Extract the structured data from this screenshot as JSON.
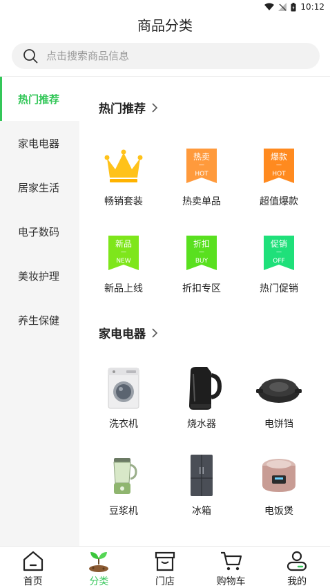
{
  "status": {
    "time": "10:12"
  },
  "header": {
    "title": "商品分类"
  },
  "search": {
    "placeholder": "点击搜索商品信息"
  },
  "sidebar": {
    "items": [
      {
        "label": "热门推荐",
        "active": true
      },
      {
        "label": "家电电器"
      },
      {
        "label": "居家生活"
      },
      {
        "label": "电子数码"
      },
      {
        "label": "美妆护理"
      },
      {
        "label": "养生保健"
      }
    ]
  },
  "sections": [
    {
      "title": "热门推荐",
      "items": [
        {
          "label": "畅销套装",
          "icon": "crown-icon"
        },
        {
          "label": "热卖单品",
          "icon": "tag-hot",
          "tag_top": "热卖",
          "tag_bottom": "HOT",
          "color": "#ff9a3c"
        },
        {
          "label": "超值爆款",
          "icon": "tag-hot",
          "tag_top": "爆款",
          "tag_bottom": "HOT",
          "color": "#ff8a1f"
        },
        {
          "label": "新品上线",
          "icon": "tag-new",
          "tag_top": "新品",
          "tag_bottom": "NEW",
          "color": "#7ee61b"
        },
        {
          "label": "折扣专区",
          "icon": "tag-buy",
          "tag_top": "折扣",
          "tag_bottom": "BUY",
          "color": "#59e01f"
        },
        {
          "label": "热门促销",
          "icon": "tag-off",
          "tag_top": "促销",
          "tag_bottom": "OFF",
          "color": "#1fe07a"
        }
      ]
    },
    {
      "title": "家电电器",
      "items": [
        {
          "label": "洗衣机",
          "icon": "washing-machine-icon"
        },
        {
          "label": "烧水器",
          "icon": "kettle-icon"
        },
        {
          "label": "电饼铛",
          "icon": "griddle-icon"
        },
        {
          "label": "豆浆机",
          "icon": "blender-icon"
        },
        {
          "label": "冰箱",
          "icon": "fridge-icon"
        },
        {
          "label": "电饭煲",
          "icon": "rice-cooker-icon"
        }
      ]
    }
  ],
  "tabbar": {
    "items": [
      {
        "label": "首页",
        "icon": "home-icon"
      },
      {
        "label": "分类",
        "icon": "sprout-icon",
        "active": true
      },
      {
        "label": "门店",
        "icon": "store-icon"
      },
      {
        "label": "购物车",
        "icon": "cart-icon"
      },
      {
        "label": "我的",
        "icon": "user-icon"
      }
    ]
  },
  "colors": {
    "accent": "#34c759",
    "sidebar_bg": "#f5f5f5"
  }
}
